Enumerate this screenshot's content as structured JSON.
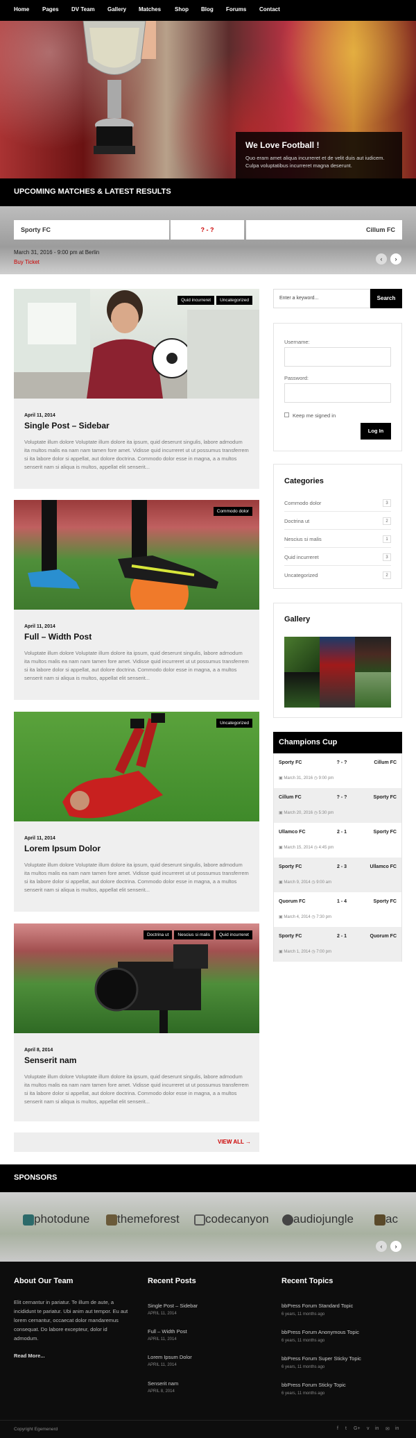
{
  "nav": [
    "Home",
    "Pages",
    "DV Team",
    "Gallery",
    "Matches",
    "Shop",
    "Blog",
    "Forums",
    "Contact"
  ],
  "hero": {
    "title": "We Love Football !",
    "text": "Quo eram amet aliqua incurreret et de velit duis aut iudicem. Culpa voluptatibus incurreret magna deserunt."
  },
  "matches": {
    "section_title": "UPCOMING MATCHES & LATEST RESULTS",
    "home": "Sporty FC",
    "score": "? - ?",
    "away": "Cillum FC",
    "date": "March 31, 2016 - 9:00 pm at Berlin",
    "buy": "Buy Ticket"
  },
  "posts": [
    {
      "date": "April 11, 2014",
      "title": "Single Post – Sidebar",
      "tags": [
        "Quid incurreret",
        "Uncategorized"
      ],
      "excerpt": "Voluptate illum dolore Voluptate illum dolore ita ipsum, quid deserunt singulis, labore admodum ita multos malis ea nam nam tamen fore amet. Vidisse quid incurreret ut ut possumus transferrem si ita labore dolor si appellat, aut dolore doctrina. Commodo dolor esse in magna, a a multos senserit nam si aliqua is multos, appellat elit senserit..."
    },
    {
      "date": "April 11, 2014",
      "title": "Full – Width Post",
      "tags": [
        "Commodo dolor"
      ],
      "excerpt": "Voluptate illum dolore Voluptate illum dolore ita ipsum, quid deserunt singulis, labore admodum ita multos malis ea nam nam tamen fore amet. Vidisse quid incurreret ut ut possumus transferrem si ita labore dolor si appellat, aut dolore doctrina. Commodo dolor esse in magna, a a multos senserit nam si aliqua is multos, appellat elit senserit..."
    },
    {
      "date": "April 11, 2014",
      "title": "Lorem Ipsum Dolor",
      "tags": [
        "Uncategorized"
      ],
      "excerpt": "Voluptate illum dolore Voluptate illum dolore ita ipsum, quid deserunt singulis, labore admodum ita multos malis ea nam nam tamen fore amet. Vidisse quid incurreret ut ut possumus transferrem si ita labore dolor si appellat, aut dolore doctrina. Commodo dolor esse in magna, a a multos senserit nam si aliqua is multos, appellat elit senserit..."
    },
    {
      "date": "April 8, 2014",
      "title": "Senserit nam",
      "tags": [
        "Doctrina ut",
        "Nescius si malis",
        "Quid incurreret"
      ],
      "excerpt": "Voluptate illum dolore Voluptate illum dolore ita ipsum, quid deserunt singulis, labore admodum ita multos malis ea nam nam tamen fore amet. Vidisse quid incurreret ut ut possumus transferrem si ita labore dolor si appellat, aut dolore doctrina. Commodo dolor esse in magna, a a multos senserit nam si aliqua is multos, appellat elit senserit..."
    }
  ],
  "view_all": "VIEW ALL →",
  "search": {
    "placeholder": "Enter a keyword...",
    "button": "Search"
  },
  "login": {
    "username": "Username:",
    "password": "Password:",
    "remember": "Keep me signed in",
    "button": "Log In"
  },
  "categories": {
    "title": "Categories",
    "items": [
      {
        "name": "Commodo dolor",
        "count": "3"
      },
      {
        "name": "Doctrina ut",
        "count": "2"
      },
      {
        "name": "Nescius si malis",
        "count": "1"
      },
      {
        "name": "Quid incurreret",
        "count": "3"
      },
      {
        "name": "Uncategorized",
        "count": "2"
      }
    ]
  },
  "gallery": {
    "title": "Gallery"
  },
  "champions": {
    "title": "Champions Cup",
    "rows": [
      {
        "home": "Sporty FC",
        "score": "? - ?",
        "away": "Cillum FC",
        "date": "March 31, 2016",
        "time": "9:00 pm"
      },
      {
        "home": "Cillum FC",
        "score": "? - ?",
        "away": "Sporty FC",
        "date": "March 20, 2016",
        "time": "5:30 pm"
      },
      {
        "home": "Ullamco FC",
        "score": "2 - 1",
        "away": "Sporty FC",
        "date": "March 15, 2014",
        "time": "4:45 pm"
      },
      {
        "home": "Sporty FC",
        "score": "2 - 3",
        "away": "Ullamco FC",
        "date": "March 9, 2014",
        "time": "9:00 am"
      },
      {
        "home": "Quorum FC",
        "score": "1 - 4",
        "away": "Sporty FC",
        "date": "March 4, 2014",
        "time": "7:30 pm"
      },
      {
        "home": "Sporty FC",
        "score": "2 - 1",
        "away": "Quorum FC",
        "date": "March 1, 2014",
        "time": "7:00 pm"
      }
    ]
  },
  "sponsors": {
    "title": "SPONSORS",
    "items": [
      "photodune",
      "themeforest",
      "codecanyon",
      "audiojungle",
      "ac"
    ]
  },
  "footer": {
    "about_title": "About Our Team",
    "about_text": "Elit cernantur in pariatur. Te illum de aute, a incididunt te pariatur. Ubi anim aut tempor. Eu aut lorem cernantur, occaecat dolor mandaremus consequat. Do labore excepteur, dolor id admodum.",
    "read_more": "Read More...",
    "recent_posts_title": "Recent Posts",
    "recent_posts": [
      {
        "title": "Single Post – Sidebar",
        "date": "APRIL 11, 2014"
      },
      {
        "title": "Full – Width Post",
        "date": "APRIL 11, 2014"
      },
      {
        "title": "Lorem Ipsum Dolor",
        "date": "APRIL 11, 2014"
      },
      {
        "title": "Senserit nam",
        "date": "APRIL 8, 2014"
      }
    ],
    "recent_topics_title": "Recent Topics",
    "recent_topics": [
      {
        "title": "bbPress Forum Standard Topic",
        "ago": "6 years, 11 months ago"
      },
      {
        "title": "bbPress Forum Anonymous Topic",
        "ago": "6 years, 11 months ago"
      },
      {
        "title": "bbPress Forum Super Sticky Topic",
        "ago": "6 years, 11 months ago"
      },
      {
        "title": "bbPress Forum Sticky Topic",
        "ago": "6 years, 11 months ago"
      }
    ],
    "copyright": "Copyright Egemenerd",
    "social": [
      "f",
      "t",
      "G+",
      "v",
      "in",
      "✉",
      "in"
    ]
  }
}
